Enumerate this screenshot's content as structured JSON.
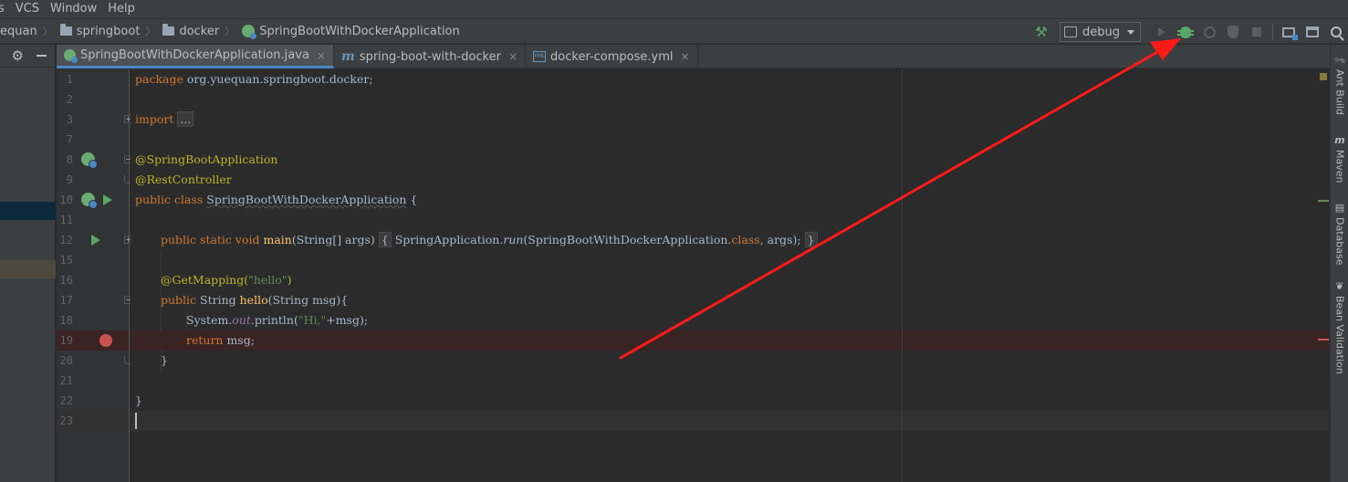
{
  "menu": [
    "s",
    "VCS",
    "Window",
    "Help"
  ],
  "breadcrumbs": [
    "equan",
    "springboot",
    "docker",
    "SpringBootWithDockerApplication"
  ],
  "run_config": {
    "label": "debug"
  },
  "tabs": [
    {
      "label": "SpringBootWithDockerApplication.java",
      "close": "×",
      "active": true
    },
    {
      "label": "spring-boot-with-docker",
      "close": "×",
      "active": false
    },
    {
      "label": "docker-compose.yml",
      "close": "×",
      "active": false
    }
  ],
  "yml_icon_text": "YML",
  "gear_glyph": "⚙",
  "hammer_glyph": "⚒",
  "lines": [
    {
      "num": "1"
    },
    {
      "num": "2"
    },
    {
      "num": "3"
    },
    {
      "num": "7"
    },
    {
      "num": "8"
    },
    {
      "num": "9"
    },
    {
      "num": "10"
    },
    {
      "num": "11"
    },
    {
      "num": "12"
    },
    {
      "num": "15"
    },
    {
      "num": "16"
    },
    {
      "num": "17"
    },
    {
      "num": "18"
    },
    {
      "num": "19"
    },
    {
      "num": "20"
    },
    {
      "num": "21"
    },
    {
      "num": "22"
    },
    {
      "num": "23"
    }
  ],
  "code": {
    "l1_kw": "package",
    "l1_rest": " org.yuequan.springboot.docker;",
    "l3_kw": "import",
    "l3_fold": "...",
    "l8": "@SpringBootApplication",
    "l9": "@RestController",
    "l10_kw": "public class",
    "l10_name": "SpringBootWithDockerApplication",
    "l10_brace": " {",
    "l12_kw": "public static void",
    "l12_fn": "main",
    "l12_args": "(String[] args)",
    "l12_body_pre": " SpringApplication.",
    "l12_run": "run",
    "l12_body_mid": "(SpringBootWithDockerApplication.",
    "l12_class": "class",
    "l12_body_post": ", args);",
    "l12_open": "{",
    "l12_close": "}",
    "l16_ann": "@GetMapping(",
    "l16_str": "\"hello\"",
    "l16_close": ")",
    "l17_kw": "public",
    "l17_type": " String ",
    "l17_fn": "hello",
    "l17_rest": "(String msg){",
    "l18_pre": "System.",
    "l18_out": "out",
    "l18_mid": ".println(",
    "l18_str": "\"Hi,\"",
    "l18_post": "+msg);",
    "l19_kw": "return",
    "l19_rest": " msg;",
    "l20": "}",
    "l22": "}"
  },
  "right_tools": [
    {
      "icon": "🐜",
      "label": "Ant Build"
    },
    {
      "icon": "m",
      "label": "Maven"
    },
    {
      "icon": "▤",
      "label": "Database"
    },
    {
      "icon": "❦",
      "label": "Bean Validation"
    }
  ],
  "colors": {
    "keyword": "#cc7832",
    "annotation": "#bbb529",
    "function": "#ffc66d",
    "string": "#6a8759",
    "static": "#9876aa",
    "breakpoint": "#c75450",
    "run_green": "#59a869",
    "arrow_red": "#ff1a1a"
  }
}
